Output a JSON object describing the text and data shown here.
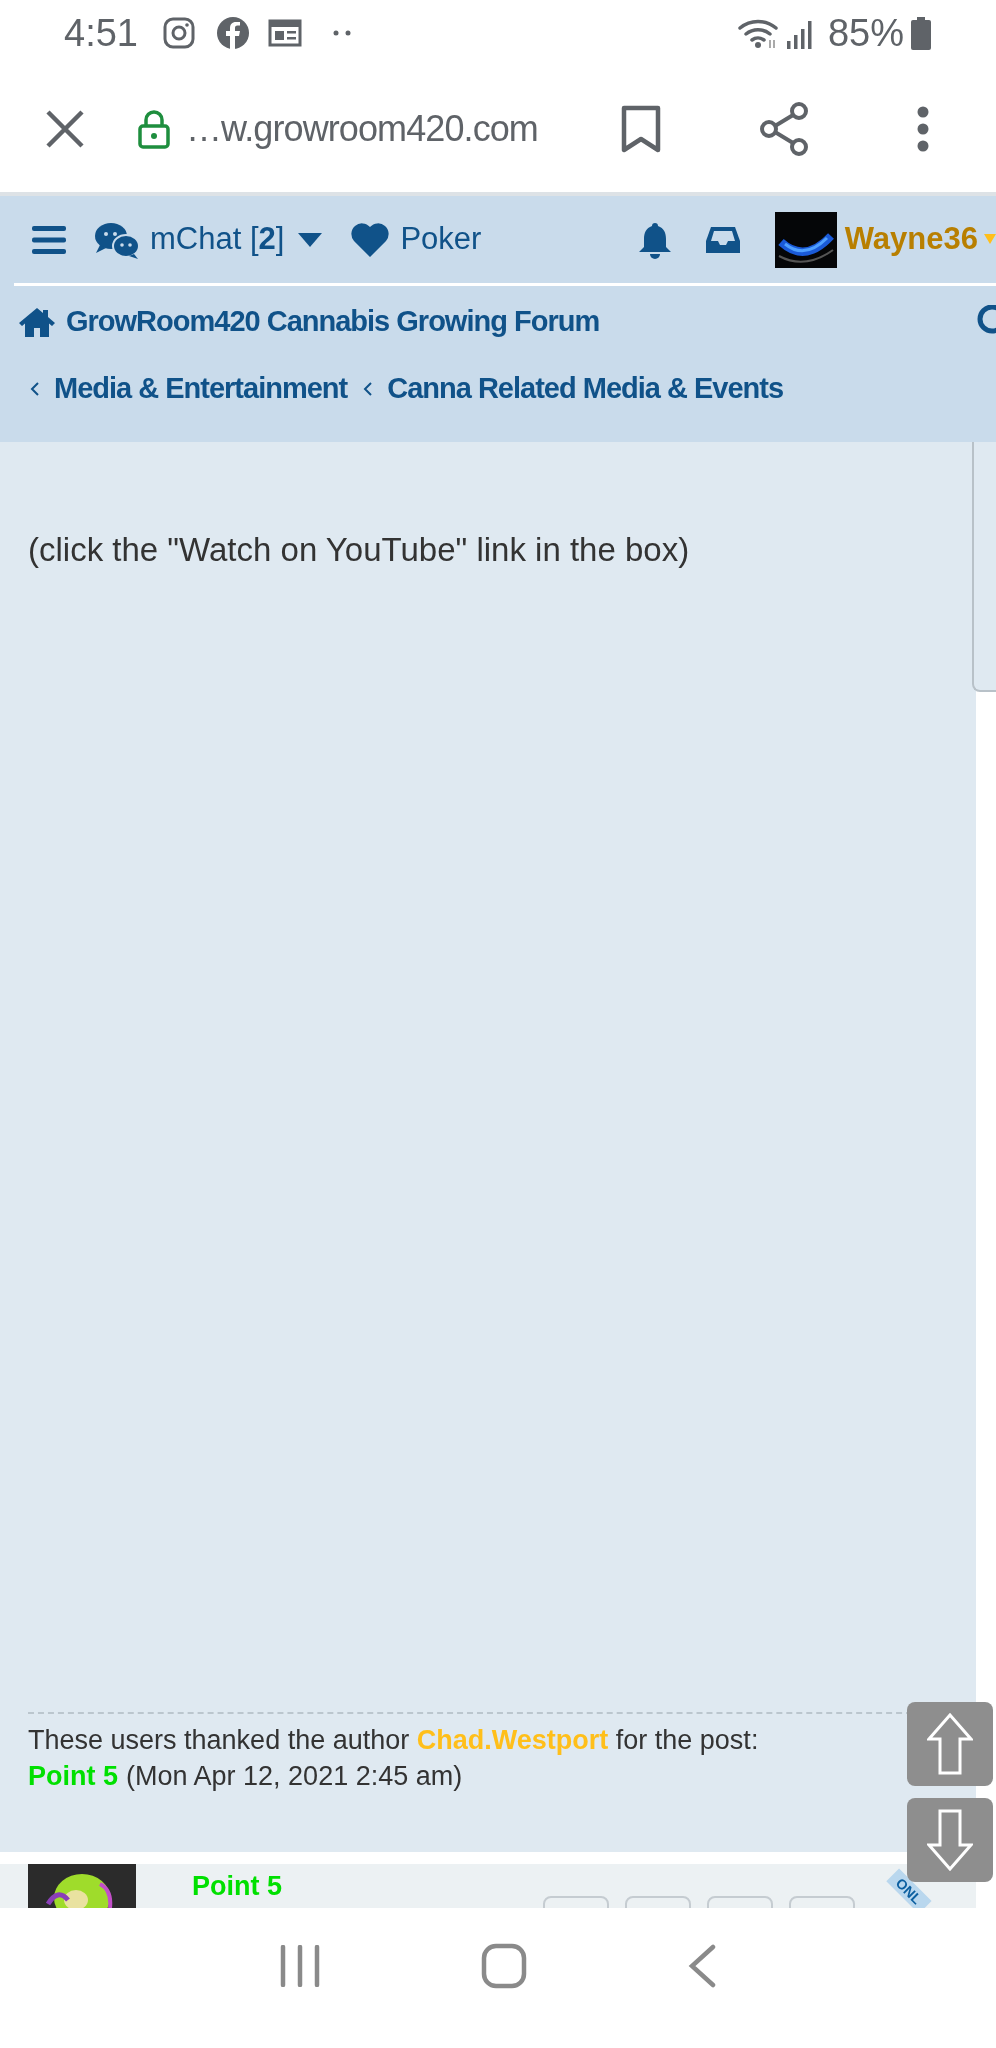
{
  "status_bar": {
    "time": "4:51",
    "battery": "85%"
  },
  "browser": {
    "url": "…w.growroom420.com"
  },
  "nav": {
    "chat": "mChat [**2**]",
    "poker": "Poker",
    "user": "Wayne36"
  },
  "breadcrumbs": {
    "home": "GrowRoom420 Cannabis Growing Forum",
    "crumbs": [
      "Media & Entertainment",
      "Canna Related Media & Events"
    ]
  },
  "post": {
    "note": "(click the \"Watch on YouTube\" link in the box)",
    "thanks": {
      "prefix": "These users thanked the author",
      "author": "Chad.Westport",
      "suffix": "for the post:",
      "users": [
        {
          "name": "Point 5",
          "date": "(Mon Apr 12, 2021 2:45 am)"
        }
      ]
    }
  },
  "next_post": {
    "author": "Point 5",
    "ribbon": "ONL"
  }
}
